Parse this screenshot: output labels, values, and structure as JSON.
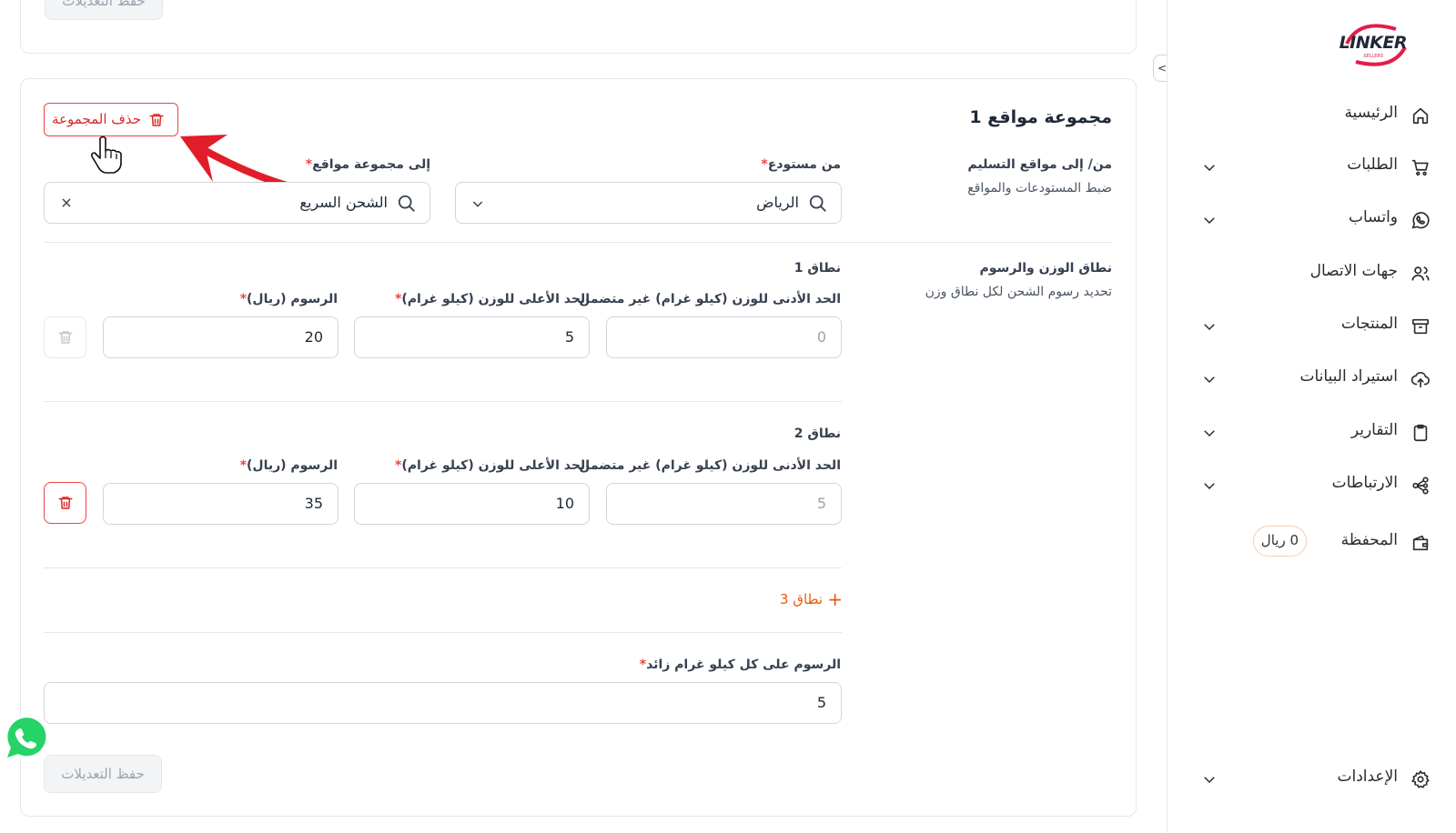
{
  "brand": {
    "logo_text": "LINKER",
    "logo_sub": "SELLERS"
  },
  "sidebar": {
    "items": [
      {
        "label": "الرئيسية",
        "icon": "home-icon",
        "has_chevron": false
      },
      {
        "label": "الطلبات",
        "icon": "cart-icon",
        "has_chevron": true
      },
      {
        "label": "واتساب",
        "icon": "whatsapp-icon",
        "has_chevron": true
      },
      {
        "label": "جهات الاتصال",
        "icon": "users-icon",
        "has_chevron": false
      },
      {
        "label": "المنتجات",
        "icon": "archive-icon",
        "has_chevron": true
      },
      {
        "label": "استيراد البيانات",
        "icon": "cloud-upload-icon",
        "has_chevron": true
      },
      {
        "label": "التقارير",
        "icon": "clipboard-icon",
        "has_chevron": true
      },
      {
        "label": "الارتباطات",
        "icon": "share-nodes-icon",
        "has_chevron": true
      },
      {
        "label": "المحفظة",
        "icon": "wallet-icon",
        "has_chevron": false,
        "badge": "0 ريال"
      }
    ],
    "settings": {
      "label": "الإعدادات",
      "icon": "gear-icon"
    }
  },
  "top_card": {
    "save_label": "حفظ التعديلات"
  },
  "group": {
    "title": "مجموعة مواقع 1",
    "delete_label": "حذف المجموعة",
    "locations_section": {
      "title": "من/ إلى مواقع التسليم",
      "subtitle": "ضبط المستودعات والمواقع"
    },
    "from_warehouse": {
      "label": "من مستودع",
      "required_mark": "*",
      "value": "الرياض"
    },
    "to_group": {
      "label": "إلى مجموعة مواقع",
      "required_mark": "*",
      "value": "الشحن السريع"
    },
    "weight_section": {
      "title": "نطاق الوزن والرسوم",
      "subtitle": "تحديد رسوم الشحن لكل نطاق وزن"
    },
    "ranges": [
      {
        "title": "نطاق 1",
        "min_label": "الحد الأدنى للوزن (كيلو غرام) غير متضمن",
        "max_label": "الحد الأعلى للوزن (كيلو غرام)",
        "fee_label": "الرسوم (ريال)",
        "required_mark": "*",
        "min_value": "0",
        "max_value": "5",
        "fee_value": "20",
        "delete_enabled": false
      },
      {
        "title": "نطاق 2",
        "min_label": "الحد الأدنى للوزن (كيلو غرام) غير متضمن",
        "max_label": "الحد الأعلى للوزن (كيلو غرام)",
        "fee_label": "الرسوم (ريال)",
        "required_mark": "*",
        "min_value": "5",
        "max_value": "10",
        "fee_value": "35",
        "delete_enabled": true
      }
    ],
    "add_range_label": "نطاق 3",
    "extra_fee": {
      "label": "الرسوم على كل كيلو غرام زائد",
      "required_mark": "*",
      "value": "5"
    },
    "save_label": "حفظ التعديلات"
  },
  "colors": {
    "accent": "#ea580c",
    "danger": "#dc2626",
    "annotation_arrow": "#e11d2a",
    "whatsapp": "#25d366"
  }
}
